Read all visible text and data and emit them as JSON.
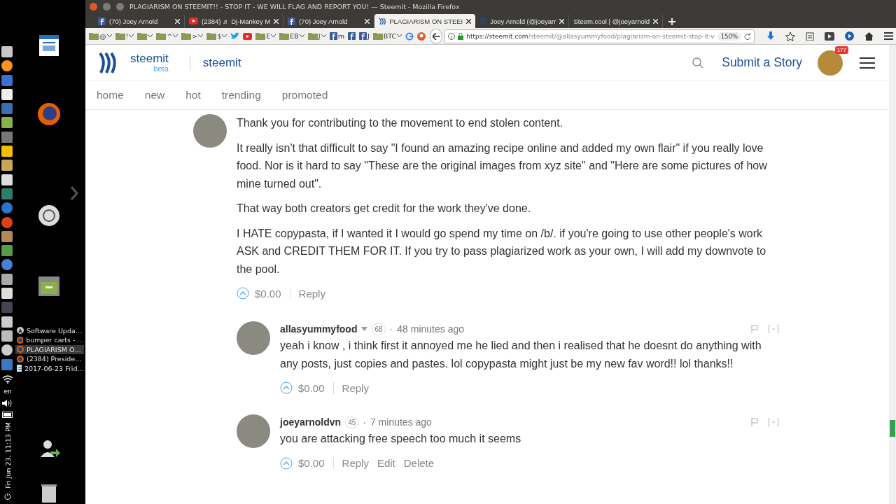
{
  "desktop": {
    "window_list": [
      {
        "label": "Software Upda…",
        "kind": "updater",
        "selected": false
      },
      {
        "label": "bumper carts - …",
        "kind": "browser",
        "selected": false
      },
      {
        "label": "PLAGIARISM O…",
        "kind": "browser",
        "selected": true
      },
      {
        "label": "(2384) Preside…",
        "kind": "browser",
        "selected": false
      },
      {
        "label": "2017-06-23 Frid…",
        "kind": "document",
        "selected": false
      }
    ],
    "keyboard_layout": "en",
    "clock": "Fri Jun 23, 11:13 PM"
  },
  "window": {
    "title": "PLAGIARISM ON STEEMIT!! - STOP IT - WE WILL FLAG AND REPORT YOU! — Steemit - Mozilla Firefox"
  },
  "tabs": [
    {
      "label": "(70) Joey Arnold",
      "kind": "facebook",
      "selected": false
    },
    {
      "label": "(2384) ♬ Dj-Mankey M",
      "kind": "youtube",
      "selected": false
    },
    {
      "label": "(70) Joey Arnold",
      "kind": "facebook",
      "selected": false
    },
    {
      "label": "PLAGIARISM ON STEEI",
      "kind": "steemit",
      "selected": true
    },
    {
      "label": "Joey Arnold (@joeyarr",
      "kind": "steemit",
      "selected": false
    },
    {
      "label": "Steem.cool | @joeyarnold",
      "kind": "blank",
      "selected": false
    }
  ],
  "bookmarks": [
    {
      "label": "@",
      "kind": "folder"
    },
    {
      "label": "!",
      "kind": "folder"
    },
    {
      "kind": "folder"
    },
    {
      "label": "^",
      "kind": "folder"
    },
    {
      "label": ">",
      "kind": "folder"
    },
    {
      "label": "$",
      "kind": "folder"
    },
    {
      "kind": "twitter"
    },
    {
      "kind": "youtube"
    },
    {
      "label": "E",
      "kind": "folder"
    },
    {
      "label": "EB",
      "kind": "folder"
    },
    {
      "label": "J",
      "kind": "folder"
    },
    {
      "label": "m",
      "kind": "facebook"
    },
    {
      "kind": "facebook"
    },
    {
      "label": "J",
      "kind": "facebook"
    },
    {
      "label": "BTC",
      "kind": "folder"
    },
    {
      "kind": "google"
    },
    {
      "kind": "duck"
    }
  ],
  "url_bar": {
    "host": "https://steemit.com",
    "path": "/steemit/@allasyummyfood/plagiarism-on-steemit-stop-it-v",
    "zoom": "150%"
  },
  "site_header": {
    "brand": "steemit",
    "beta": "beta",
    "section": "steemit",
    "submit": "Submit a Story",
    "notifications": "177"
  },
  "nav": [
    {
      "label": "home"
    },
    {
      "label": "new"
    },
    {
      "label": "hot"
    },
    {
      "label": "trending"
    },
    {
      "label": "promoted"
    }
  ],
  "comments": [
    {
      "paragraphs": [
        "Thank you for contributing to the movement to end stolen content.",
        "It really isn't that difficult to say \"I found an amazing recipe online and added my own flair\" if you really love food. Nor is it hard to say \"These are the original images from xyz site\" and \"Here are some pictures of how mine turned out\".",
        "That way both creators get credit for the work they've done.",
        "I HATE copypasta, if I wanted it I would go spend my time on /b/. if you're going to use other people's work ASK and CREDIT THEM FOR IT. If you try to pass plagiarized work as your own, I will add my downvote to the pool."
      ],
      "payout": "$0.00",
      "actions": [
        "Reply"
      ],
      "children": [
        {
          "author": "allasyummyfood",
          "has_menu": true,
          "reputation": "68",
          "separator": "·",
          "time": "48 minutes ago",
          "paragraphs": [
            "yeah i know , i think first it annoyed me he lied and then i realised that he doesnt do anything with any posts, just copies and pastes. lol copypasta might just be my new fav word!! lol thanks!!"
          ],
          "payout": "$0.00",
          "actions": [
            "Reply"
          ]
        },
        {
          "author": "joeyarnoldvn",
          "has_menu": false,
          "reputation": "45",
          "separator": "·",
          "time": "7 minutes ago",
          "paragraphs": [
            "you are attacking free speech too much it seems"
          ],
          "payout": "$0.00",
          "actions": [
            "Reply",
            "Edit",
            "Delete"
          ]
        }
      ]
    }
  ]
}
